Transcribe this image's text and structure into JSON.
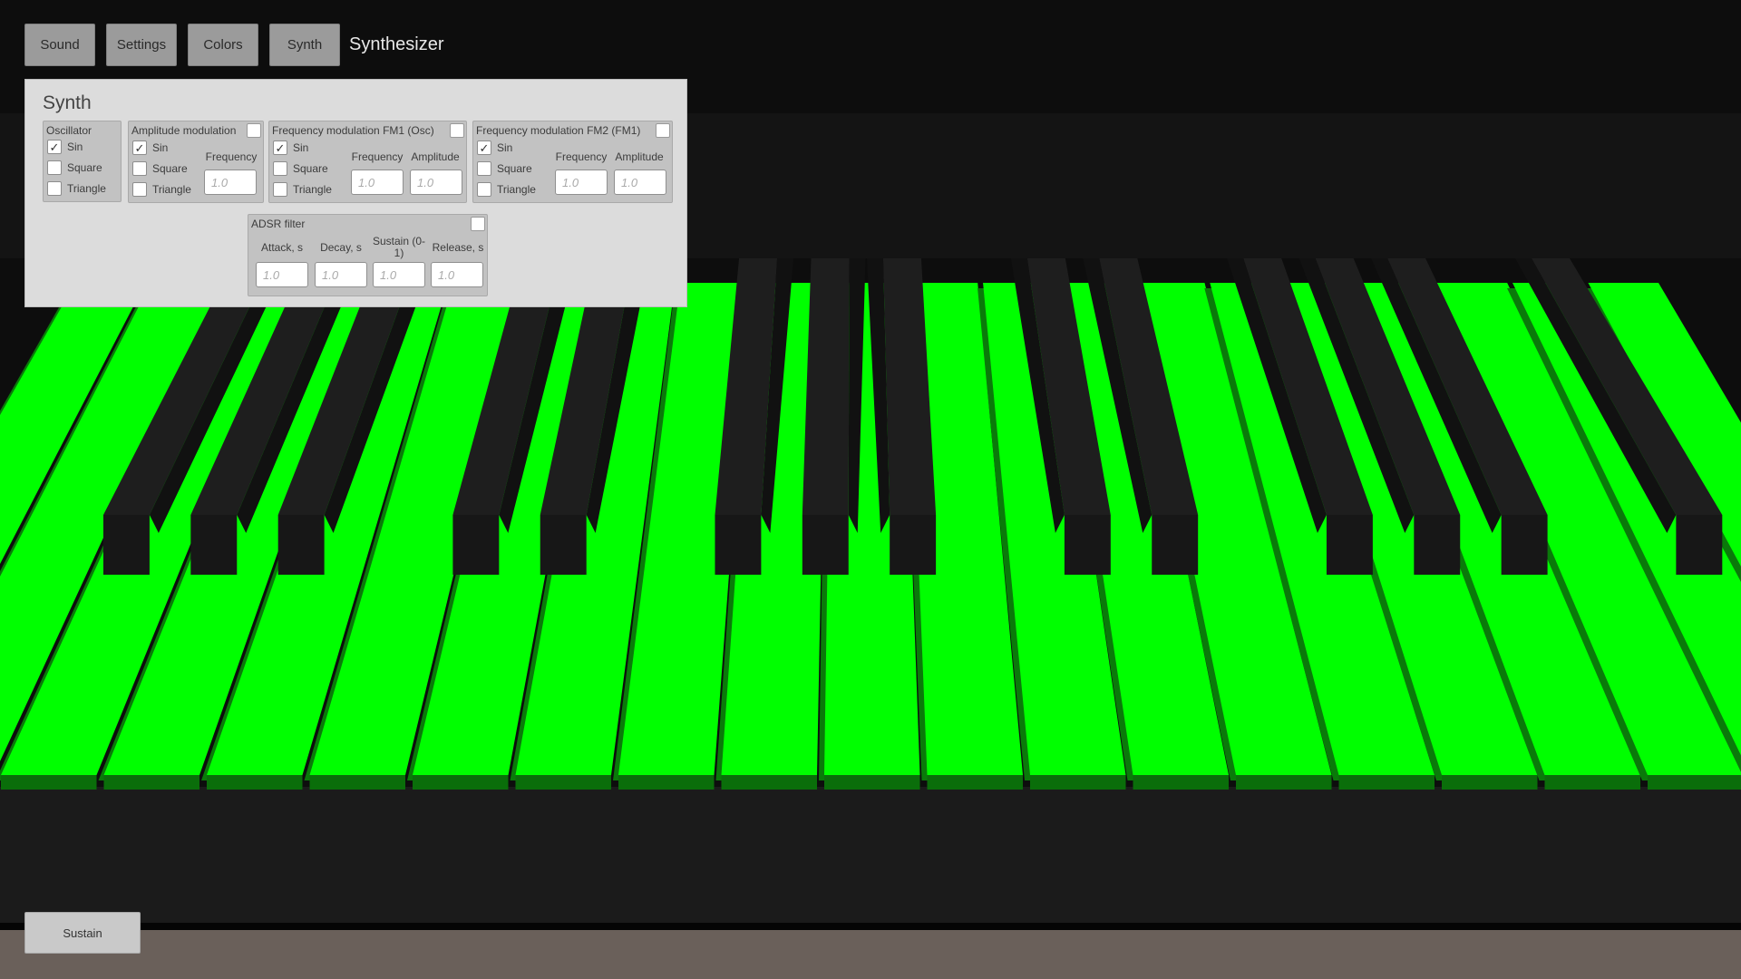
{
  "app": {
    "title": "Synthesizer"
  },
  "toolbar": {
    "sound_label": "Sound",
    "settings_label": "Settings",
    "colors_label": "Colors",
    "synth_label": "Synth"
  },
  "panel": {
    "title": "Synth",
    "oscillator": {
      "title": "Oscillator",
      "options": [
        {
          "label": "Sin",
          "checked": true
        },
        {
          "label": "Square",
          "checked": false
        },
        {
          "label": "Triangle",
          "checked": false
        }
      ]
    },
    "am": {
      "title": "Amplitude modulation",
      "enabled": false,
      "options": [
        {
          "label": "Sin",
          "checked": true
        },
        {
          "label": "Square",
          "checked": false
        },
        {
          "label": "Triangle",
          "checked": false
        }
      ],
      "frequency_label": "Frequency",
      "frequency_placeholder": "1.0"
    },
    "fm1": {
      "title": "Frequency modulation FM1 (Osc)",
      "enabled": false,
      "options": [
        {
          "label": "Sin",
          "checked": true
        },
        {
          "label": "Square",
          "checked": false
        },
        {
          "label": "Triangle",
          "checked": false
        }
      ],
      "frequency_label": "Frequency",
      "amplitude_label": "Amplitude",
      "frequency_placeholder": "1.0",
      "amplitude_placeholder": "1.0"
    },
    "fm2": {
      "title": "Frequency modulation FM2 (FM1)",
      "enabled": false,
      "options": [
        {
          "label": "Sin",
          "checked": true
        },
        {
          "label": "Square",
          "checked": false
        },
        {
          "label": "Triangle",
          "checked": false
        }
      ],
      "frequency_label": "Frequency",
      "amplitude_label": "Amplitude",
      "frequency_placeholder": "1.0",
      "amplitude_placeholder": "1.0"
    },
    "adsr": {
      "title": "ADSR filter",
      "enabled": false,
      "attack_label": "Attack, s",
      "decay_label": "Decay, s",
      "sustain_label": "Sustain (0-1)",
      "release_label": "Release, s",
      "attack_placeholder": "1.0",
      "decay_placeholder": "1.0",
      "sustain_placeholder": "1.0",
      "release_placeholder": "1.0"
    }
  },
  "footer": {
    "sustain_label": "Sustain"
  },
  "colors": {
    "white_key": "#00ff00",
    "white_key_shade": "#0a7a0a",
    "black_key": "#1e1e1e",
    "floor": "#6a605a"
  }
}
